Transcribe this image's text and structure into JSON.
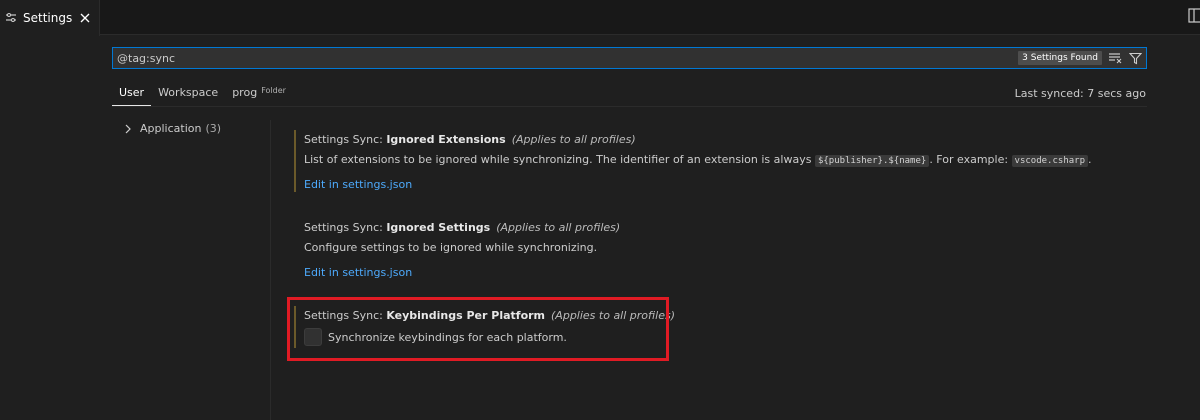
{
  "tabbar": {
    "tab_label": "Settings",
    "icons": {
      "settings": "settings-lines-icon",
      "close": "close-icon",
      "actions": "split-editor-icon"
    }
  },
  "search": {
    "value": "@tag:sync",
    "count_badge": "3 Settings Found",
    "icons": [
      "clear-filter-icon",
      "filter-icon"
    ]
  },
  "scope": {
    "tabs": [
      {
        "label": "User",
        "active": true
      },
      {
        "label": "Workspace",
        "active": false
      },
      {
        "label": "prog",
        "hint": "Folder",
        "active": false
      }
    ],
    "last_synced": "Last synced: 7 secs ago"
  },
  "toc": {
    "items": [
      {
        "label": "Application",
        "count": "(3)"
      }
    ]
  },
  "settings": [
    {
      "category": "Settings Sync: ",
      "key": "Ignored Extensions",
      "scope_note": "(Applies to all profiles)",
      "desc_pre": "List of extensions to be ignored while synchronizing. The identifier of an extension is always ",
      "code1": "${publisher}.${name}",
      "desc_mid": ". For example: ",
      "code2": "vscode.csharp",
      "desc_post": ".",
      "edit_link": "Edit in settings.json"
    },
    {
      "category": "Settings Sync: ",
      "key": "Ignored Settings",
      "scope_note": "(Applies to all profiles)",
      "desc": "Configure settings to be ignored while synchronizing.",
      "edit_link": "Edit in settings.json"
    },
    {
      "category": "Settings Sync: ",
      "key": "Keybindings Per Platform",
      "scope_note": "(Applies to all profiles)",
      "checkbox_label": "Synchronize keybindings for each platform.",
      "checked": false
    }
  ],
  "colors": {
    "accent": "#0078d4",
    "link": "#4daafc",
    "highlight": "#e01b24"
  }
}
